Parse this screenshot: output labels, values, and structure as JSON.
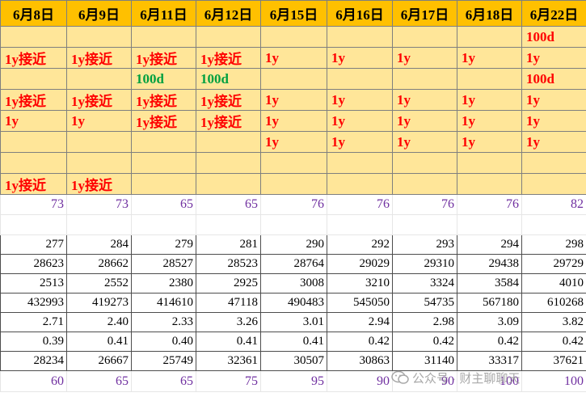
{
  "dates": [
    "6月8日",
    "6月9日",
    "6月11日",
    "6月12日",
    "6月15日",
    "6月16日",
    "6月17日",
    "6月18日",
    "6月22日"
  ],
  "signal_rows": [
    [
      {
        "t": "",
        "c": ""
      },
      {
        "t": "",
        "c": ""
      },
      {
        "t": "",
        "c": ""
      },
      {
        "t": "",
        "c": ""
      },
      {
        "t": "",
        "c": ""
      },
      {
        "t": "",
        "c": ""
      },
      {
        "t": "",
        "c": ""
      },
      {
        "t": "",
        "c": ""
      },
      {
        "t": "100d",
        "c": "red"
      }
    ],
    [
      {
        "t": "1y接近",
        "c": "red"
      },
      {
        "t": "1y接近",
        "c": "red"
      },
      {
        "t": "1y接近",
        "c": "red"
      },
      {
        "t": "1y接近",
        "c": "red"
      },
      {
        "t": "1y",
        "c": "red"
      },
      {
        "t": "1y",
        "c": "red"
      },
      {
        "t": "1y",
        "c": "red"
      },
      {
        "t": "1y",
        "c": "red"
      },
      {
        "t": "1y",
        "c": "red"
      }
    ],
    [
      {
        "t": "",
        "c": ""
      },
      {
        "t": "",
        "c": ""
      },
      {
        "t": "100d",
        "c": "green"
      },
      {
        "t": "100d",
        "c": "green"
      },
      {
        "t": "",
        "c": ""
      },
      {
        "t": "",
        "c": ""
      },
      {
        "t": "",
        "c": ""
      },
      {
        "t": "",
        "c": ""
      },
      {
        "t": "100d",
        "c": "red"
      }
    ],
    [
      {
        "t": "1y接近",
        "c": "red"
      },
      {
        "t": "1y接近",
        "c": "red"
      },
      {
        "t": "1y接近",
        "c": "red"
      },
      {
        "t": "1y接近",
        "c": "red"
      },
      {
        "t": "1y",
        "c": "red"
      },
      {
        "t": "1y",
        "c": "red"
      },
      {
        "t": "1y",
        "c": "red"
      },
      {
        "t": "1y",
        "c": "red"
      },
      {
        "t": "1y",
        "c": "red"
      }
    ],
    [
      {
        "t": "1y",
        "c": "red"
      },
      {
        "t": "1y",
        "c": "red"
      },
      {
        "t": "1y接近",
        "c": "red"
      },
      {
        "t": "1y接近",
        "c": "red"
      },
      {
        "t": "1y",
        "c": "red"
      },
      {
        "t": "1y",
        "c": "red"
      },
      {
        "t": "1y",
        "c": "red"
      },
      {
        "t": "1y",
        "c": "red"
      },
      {
        "t": "1y",
        "c": "red"
      }
    ],
    [
      {
        "t": "",
        "c": ""
      },
      {
        "t": "",
        "c": ""
      },
      {
        "t": "",
        "c": ""
      },
      {
        "t": "",
        "c": ""
      },
      {
        "t": "1y",
        "c": "red"
      },
      {
        "t": "1y",
        "c": "red"
      },
      {
        "t": "1y",
        "c": "red"
      },
      {
        "t": "1y",
        "c": "red"
      },
      {
        "t": "1y",
        "c": "red"
      }
    ],
    [
      {
        "t": "",
        "c": ""
      },
      {
        "t": "",
        "c": ""
      },
      {
        "t": "",
        "c": ""
      },
      {
        "t": "",
        "c": ""
      },
      {
        "t": "",
        "c": ""
      },
      {
        "t": "",
        "c": ""
      },
      {
        "t": "",
        "c": ""
      },
      {
        "t": "",
        "c": ""
      },
      {
        "t": "",
        "c": ""
      }
    ],
    [
      {
        "t": "1y接近",
        "c": "red"
      },
      {
        "t": "1y接近",
        "c": "red"
      },
      {
        "t": "",
        "c": ""
      },
      {
        "t": "",
        "c": ""
      },
      {
        "t": "",
        "c": ""
      },
      {
        "t": "",
        "c": ""
      },
      {
        "t": "",
        "c": ""
      },
      {
        "t": "",
        "c": ""
      },
      {
        "t": "",
        "c": ""
      }
    ]
  ],
  "score_row": [
    "73",
    "73",
    "65",
    "65",
    "76",
    "76",
    "76",
    "76",
    "82"
  ],
  "data_rows": [
    [
      "277",
      "284",
      "279",
      "281",
      "290",
      "292",
      "293",
      "294",
      "298"
    ],
    [
      "28623",
      "28662",
      "28527",
      "28523",
      "28764",
      "29029",
      "29310",
      "29438",
      "29729"
    ],
    [
      "2513",
      "2552",
      "2380",
      "2925",
      "3008",
      "3210",
      "3324",
      "3584",
      "4010"
    ],
    [
      "432993",
      "419273",
      "414610",
      "47118",
      "490483",
      "545050",
      "54735",
      "567180",
      "610268"
    ],
    [
      "2.71",
      "2.40",
      "2.33",
      "3.26",
      "3.01",
      "2.94",
      "2.98",
      "3.09",
      "3.82"
    ],
    [
      "0.39",
      "0.41",
      "0.40",
      "0.41",
      "0.41",
      "0.42",
      "0.42",
      "0.42",
      "0.42"
    ],
    [
      "28234",
      "26667",
      "25749",
      "32361",
      "30507",
      "30863",
      "31140",
      "33317",
      "37621"
    ]
  ],
  "bottom_row": [
    "60",
    "65",
    "65",
    "75",
    "95",
    "90",
    "90",
    "100",
    "100"
  ],
  "watermark": "公众号 · 财主聊聊天",
  "colors": {
    "header_bg": "#FFC000",
    "signal_bg": "#FFE699",
    "signal_red": "#FF0000",
    "signal_green": "#00A040",
    "score_purple": "#7030A0"
  }
}
